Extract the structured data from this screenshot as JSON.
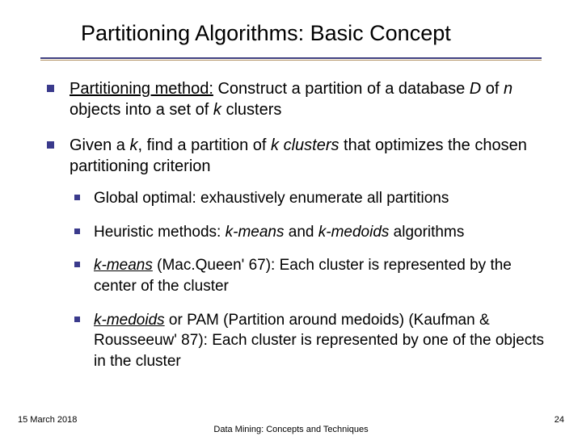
{
  "title": "Partitioning Algorithms: Basic Concept",
  "bullets": [
    {
      "t1": "Partitioning method:",
      "t2": " Construct a partition of a database ",
      "t3": "D",
      "t4": " of ",
      "t5": "n",
      "t6": " objects into a set of ",
      "t7": "k",
      "t8": " clusters"
    },
    {
      "t1": "Given a ",
      "t2": "k",
      "t3": ", find a partition of ",
      "t4": "k clusters",
      "t5": " that optimizes the chosen partitioning criterion",
      "sub": [
        {
          "a": "Global optimal: exhaustively enumerate all partitions"
        },
        {
          "a": "Heuristic methods: ",
          "b": "k-means",
          "c": " and ",
          "d": "k-medoids",
          "e": " algorithms"
        },
        {
          "a": "k-means",
          "b": " (Mac.Queen' 67): Each cluster is represented by the center of the cluster"
        },
        {
          "a": "k-medoids",
          "b": " or PAM (Partition around medoids) (Kaufman & Rousseeuw' 87): Each cluster is represented by one of the objects in the cluster"
        }
      ]
    }
  ],
  "footer": {
    "date": "15 March 2018",
    "title": "Data Mining: Concepts and Techniques",
    "page": "24"
  }
}
